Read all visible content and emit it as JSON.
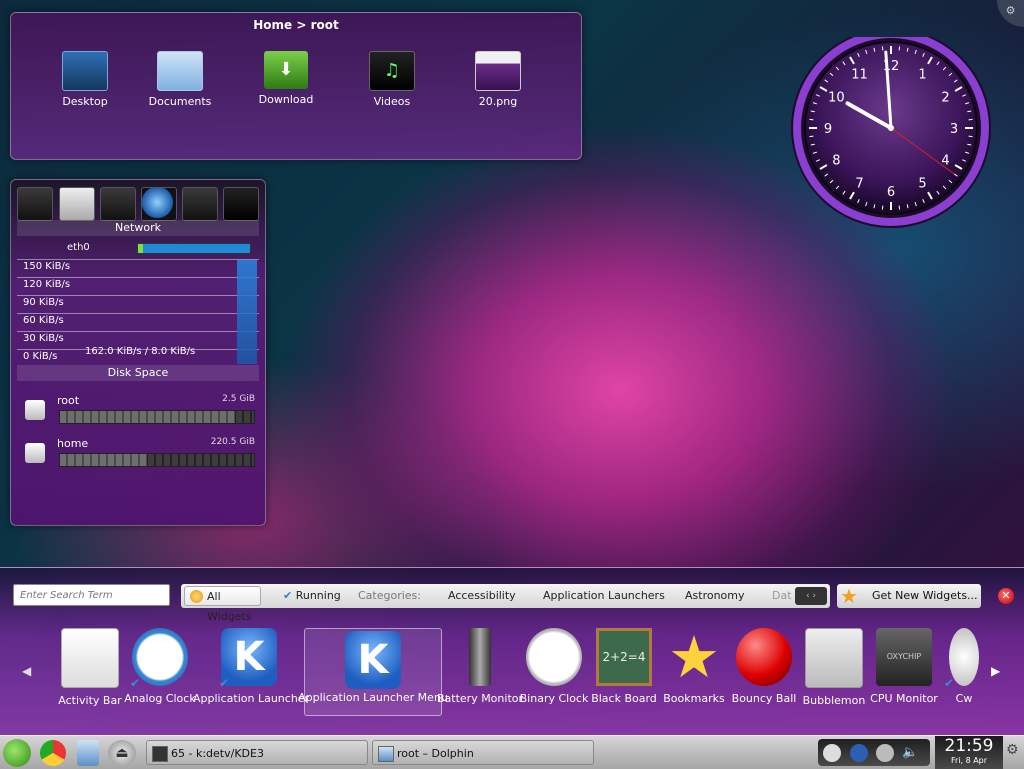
{
  "folderview": {
    "title": "Home > root",
    "items": [
      {
        "label": "Desktop",
        "icon": "desktop-folder-icon"
      },
      {
        "label": "Documents",
        "icon": "documents-folder-icon"
      },
      {
        "label": "Download",
        "icon": "download-folder-icon"
      },
      {
        "label": "Videos",
        "icon": "videos-folder-icon"
      },
      {
        "label": "20.png",
        "icon": "image-file-icon"
      }
    ]
  },
  "sysmon": {
    "icons": [
      "hardware-icon",
      "hard-disk-icon",
      "media-device-icon",
      "network-icon",
      "ram-icon",
      "cpu-chip-icon"
    ],
    "network_title": "Network",
    "interface": "eth0",
    "grid_labels": [
      "150 KiB/s",
      "120 KiB/s",
      "90 KiB/s",
      "60 KiB/s",
      "30 KiB/s",
      "0 KiB/s"
    ],
    "rate": "162.0 KiB/s / 8.0 KiB/s",
    "disk_title": "Disk Space",
    "disks": [
      {
        "name": "root",
        "size": "2.5 GiB",
        "used_fraction": 0.9
      },
      {
        "name": "home",
        "size": "220.5 GiB",
        "used_fraction": 0.45
      }
    ]
  },
  "clock": {
    "numbers": [
      "12",
      "1",
      "2",
      "3",
      "4",
      "5",
      "6",
      "7",
      "8",
      "9",
      "10",
      "11"
    ],
    "time": {
      "hour": 9,
      "minute": 59,
      "second": 21
    }
  },
  "explorer": {
    "search_placeholder": "Enter Search Term",
    "filters": {
      "all_widgets": "All Widgets",
      "running": "Running",
      "categories_label": "Categories:",
      "categories": [
        "Accessibility",
        "Application Launchers",
        "Astronomy",
        "Dat"
      ]
    },
    "get_new": "Get New Widgets...",
    "close": "✕",
    "widgets": [
      {
        "label": "Activity Bar",
        "running": false
      },
      {
        "label": "Analog Clock",
        "running": true
      },
      {
        "label": "Application Launcher",
        "running": true
      },
      {
        "label": "Application Launcher Menu",
        "running": false
      },
      {
        "label": "Battery Monitor",
        "running": false
      },
      {
        "label": "Binary Clock",
        "running": false
      },
      {
        "label": "Black Board",
        "running": false
      },
      {
        "label": "Bookmarks",
        "running": false
      },
      {
        "label": "Bouncy Ball",
        "running": false
      },
      {
        "label": "Bubblemon",
        "running": false
      },
      {
        "label": "CPU Monitor",
        "running": false
      },
      {
        "label": "Cw",
        "running": true
      }
    ],
    "black_board_text": "2+2=4",
    "cpu_chip_text": "OXYCHIP"
  },
  "taskbar": {
    "tasks": [
      "65 - k:detv/KDE3",
      "root – Dolphin"
    ],
    "clock_time": "21:59",
    "clock_date": "Fri, 8 Apr"
  },
  "colors": {
    "accent": "#9b3fc0",
    "explorer_bg": "#7a2fa0",
    "close_red": "#d00000"
  }
}
